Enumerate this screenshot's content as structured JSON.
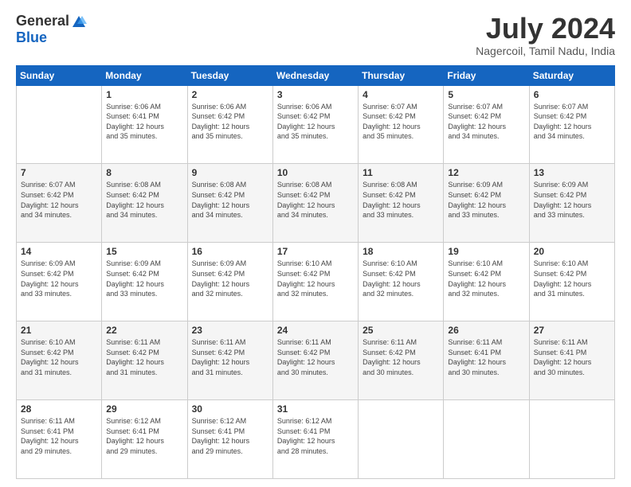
{
  "logo": {
    "general": "General",
    "blue": "Blue"
  },
  "header": {
    "month": "July 2024",
    "location": "Nagercoil, Tamil Nadu, India"
  },
  "days": [
    "Sunday",
    "Monday",
    "Tuesday",
    "Wednesday",
    "Thursday",
    "Friday",
    "Saturday"
  ],
  "weeks": [
    [
      {
        "day": "",
        "info": ""
      },
      {
        "day": "1",
        "info": "Sunrise: 6:06 AM\nSunset: 6:41 PM\nDaylight: 12 hours\nand 35 minutes."
      },
      {
        "day": "2",
        "info": "Sunrise: 6:06 AM\nSunset: 6:42 PM\nDaylight: 12 hours\nand 35 minutes."
      },
      {
        "day": "3",
        "info": "Sunrise: 6:06 AM\nSunset: 6:42 PM\nDaylight: 12 hours\nand 35 minutes."
      },
      {
        "day": "4",
        "info": "Sunrise: 6:07 AM\nSunset: 6:42 PM\nDaylight: 12 hours\nand 35 minutes."
      },
      {
        "day": "5",
        "info": "Sunrise: 6:07 AM\nSunset: 6:42 PM\nDaylight: 12 hours\nand 34 minutes."
      },
      {
        "day": "6",
        "info": "Sunrise: 6:07 AM\nSunset: 6:42 PM\nDaylight: 12 hours\nand 34 minutes."
      }
    ],
    [
      {
        "day": "7",
        "info": ""
      },
      {
        "day": "8",
        "info": "Sunrise: 6:08 AM\nSunset: 6:42 PM\nDaylight: 12 hours\nand 34 minutes."
      },
      {
        "day": "9",
        "info": "Sunrise: 6:08 AM\nSunset: 6:42 PM\nDaylight: 12 hours\nand 34 minutes."
      },
      {
        "day": "10",
        "info": "Sunrise: 6:08 AM\nSunset: 6:42 PM\nDaylight: 12 hours\nand 34 minutes."
      },
      {
        "day": "11",
        "info": "Sunrise: 6:08 AM\nSunset: 6:42 PM\nDaylight: 12 hours\nand 33 minutes."
      },
      {
        "day": "12",
        "info": "Sunrise: 6:09 AM\nSunset: 6:42 PM\nDaylight: 12 hours\nand 33 minutes."
      },
      {
        "day": "13",
        "info": "Sunrise: 6:09 AM\nSunset: 6:42 PM\nDaylight: 12 hours\nand 33 minutes."
      }
    ],
    [
      {
        "day": "14",
        "info": ""
      },
      {
        "day": "15",
        "info": "Sunrise: 6:09 AM\nSunset: 6:42 PM\nDaylight: 12 hours\nand 33 minutes."
      },
      {
        "day": "16",
        "info": "Sunrise: 6:09 AM\nSunset: 6:42 PM\nDaylight: 12 hours\nand 32 minutes."
      },
      {
        "day": "17",
        "info": "Sunrise: 6:10 AM\nSunset: 6:42 PM\nDaylight: 12 hours\nand 32 minutes."
      },
      {
        "day": "18",
        "info": "Sunrise: 6:10 AM\nSunset: 6:42 PM\nDaylight: 12 hours\nand 32 minutes."
      },
      {
        "day": "19",
        "info": "Sunrise: 6:10 AM\nSunset: 6:42 PM\nDaylight: 12 hours\nand 32 minutes."
      },
      {
        "day": "20",
        "info": "Sunrise: 6:10 AM\nSunset: 6:42 PM\nDaylight: 12 hours\nand 31 minutes."
      }
    ],
    [
      {
        "day": "21",
        "info": ""
      },
      {
        "day": "22",
        "info": "Sunrise: 6:11 AM\nSunset: 6:42 PM\nDaylight: 12 hours\nand 31 minutes."
      },
      {
        "day": "23",
        "info": "Sunrise: 6:11 AM\nSunset: 6:42 PM\nDaylight: 12 hours\nand 31 minutes."
      },
      {
        "day": "24",
        "info": "Sunrise: 6:11 AM\nSunset: 6:42 PM\nDaylight: 12 hours\nand 30 minutes."
      },
      {
        "day": "25",
        "info": "Sunrise: 6:11 AM\nSunset: 6:42 PM\nDaylight: 12 hours\nand 30 minutes."
      },
      {
        "day": "26",
        "info": "Sunrise: 6:11 AM\nSunset: 6:41 PM\nDaylight: 12 hours\nand 30 minutes."
      },
      {
        "day": "27",
        "info": "Sunrise: 6:11 AM\nSunset: 6:41 PM\nDaylight: 12 hours\nand 30 minutes."
      }
    ],
    [
      {
        "day": "28",
        "info": "Sunrise: 6:11 AM\nSunset: 6:41 PM\nDaylight: 12 hours\nand 29 minutes."
      },
      {
        "day": "29",
        "info": "Sunrise: 6:12 AM\nSunset: 6:41 PM\nDaylight: 12 hours\nand 29 minutes."
      },
      {
        "day": "30",
        "info": "Sunrise: 6:12 AM\nSunset: 6:41 PM\nDaylight: 12 hours\nand 29 minutes."
      },
      {
        "day": "31",
        "info": "Sunrise: 6:12 AM\nSunset: 6:41 PM\nDaylight: 12 hours\nand 28 minutes."
      },
      {
        "day": "",
        "info": ""
      },
      {
        "day": "",
        "info": ""
      },
      {
        "day": "",
        "info": ""
      }
    ]
  ],
  "week7_sunday": "Sunrise: 6:07 AM\nSunset: 6:42 PM\nDaylight: 12 hours\nand 34 minutes.",
  "week14_sunday": "Sunrise: 6:09 AM\nSunset: 6:42 PM\nDaylight: 12 hours\nand 33 minutes.",
  "week21_sunday": "Sunrise: 6:10 AM\nSunset: 6:42 PM\nDaylight: 12 hours\nand 31 minutes."
}
